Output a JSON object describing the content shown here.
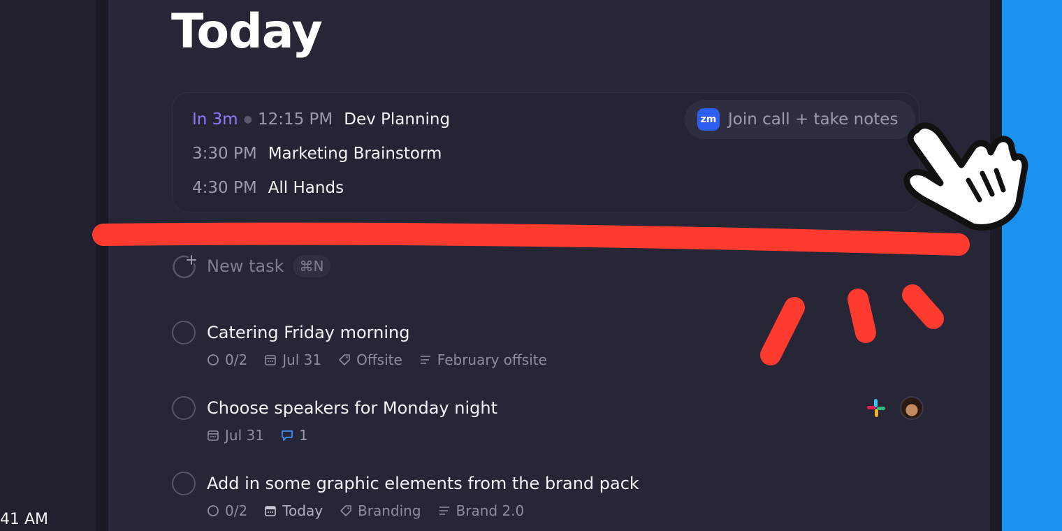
{
  "colors": {
    "background": "#262637",
    "accent_soon": "#8b7cff",
    "zoom": "#2f5ff0",
    "sidebar_blue": "#1a93f0",
    "annotation_red": "#ff3b2f"
  },
  "status_bar": {
    "clock": "41 AM"
  },
  "page": {
    "title": "Today"
  },
  "meetings": {
    "rows": [
      {
        "soon": "In 3m",
        "time": "12:15 PM",
        "title": "Dev Planning"
      },
      {
        "time": "3:30 PM",
        "title": "Marketing Brainstorm"
      },
      {
        "time": "4:30 PM",
        "title": "All Hands"
      }
    ],
    "join": {
      "badge": "zm",
      "label": "Join call + take notes",
      "icon": "zoom-icon"
    }
  },
  "new_task": {
    "label": "New task",
    "shortcut": "⌘N",
    "icon": "new-task-plus-icon"
  },
  "tasks": [
    {
      "title": "Catering Friday morning",
      "subtasks": "0/2",
      "date": "Jul 31",
      "tag": "Offsite",
      "project": "February offsite"
    },
    {
      "title": "Choose speakers for Monday night",
      "date": "Jul 31",
      "comments": "1",
      "icons": [
        "slack-icon",
        "avatar"
      ]
    },
    {
      "title": "Add in some graphic elements from the brand pack",
      "subtasks": "0/2",
      "date": "Today",
      "tag": "Branding",
      "project": "Brand 2.0"
    }
  ],
  "annotation": {
    "cursor_icon": "hand-pointer-icon"
  }
}
